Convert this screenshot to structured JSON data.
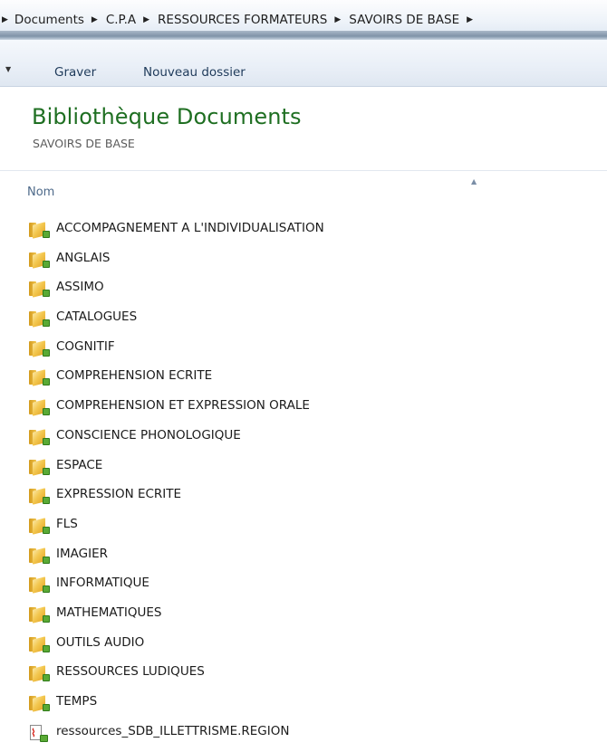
{
  "breadcrumb": {
    "items": [
      {
        "label": "Documents"
      },
      {
        "label": "C.P.A"
      },
      {
        "label": "RESSOURCES FORMATEURS"
      },
      {
        "label": "SAVOIRS DE BASE"
      }
    ]
  },
  "toolbar": {
    "graver_label": "Graver",
    "nouveau_dossier_label": "Nouveau dossier"
  },
  "library": {
    "title": "Bibliothèque Documents",
    "subtitle": "SAVOIRS DE BASE"
  },
  "columns": {
    "name_header": "Nom"
  },
  "files": [
    {
      "name": "ACCOMPAGNEMENT A L'INDIVIDUALISATION",
      "type": "folder"
    },
    {
      "name": "ANGLAIS",
      "type": "folder"
    },
    {
      "name": "ASSIMO",
      "type": "folder"
    },
    {
      "name": "CATALOGUES",
      "type": "folder"
    },
    {
      "name": "COGNITIF",
      "type": "folder"
    },
    {
      "name": "COMPREHENSION ECRITE",
      "type": "folder"
    },
    {
      "name": "COMPREHENSION ET EXPRESSION ORALE",
      "type": "folder"
    },
    {
      "name": "CONSCIENCE PHONOLOGIQUE",
      "type": "folder"
    },
    {
      "name": "ESPACE",
      "type": "folder"
    },
    {
      "name": "EXPRESSION ECRITE",
      "type": "folder"
    },
    {
      "name": "FLS",
      "type": "folder"
    },
    {
      "name": "IMAGIER",
      "type": "folder"
    },
    {
      "name": "INFORMATIQUE",
      "type": "folder"
    },
    {
      "name": "MATHEMATIQUES",
      "type": "folder"
    },
    {
      "name": "OUTILS AUDIO",
      "type": "folder"
    },
    {
      "name": "RESSOURCES LUDIQUES",
      "type": "folder"
    },
    {
      "name": "TEMPS",
      "type": "folder"
    },
    {
      "name": "ressources_SDB_ILLETTRISME.REGION",
      "type": "pdf"
    }
  ],
  "colors": {
    "title_green": "#1f6f22",
    "folder_yellow": "#f3c74f",
    "pdf_red": "#d7261e",
    "badge_green": "#5aaa35"
  }
}
